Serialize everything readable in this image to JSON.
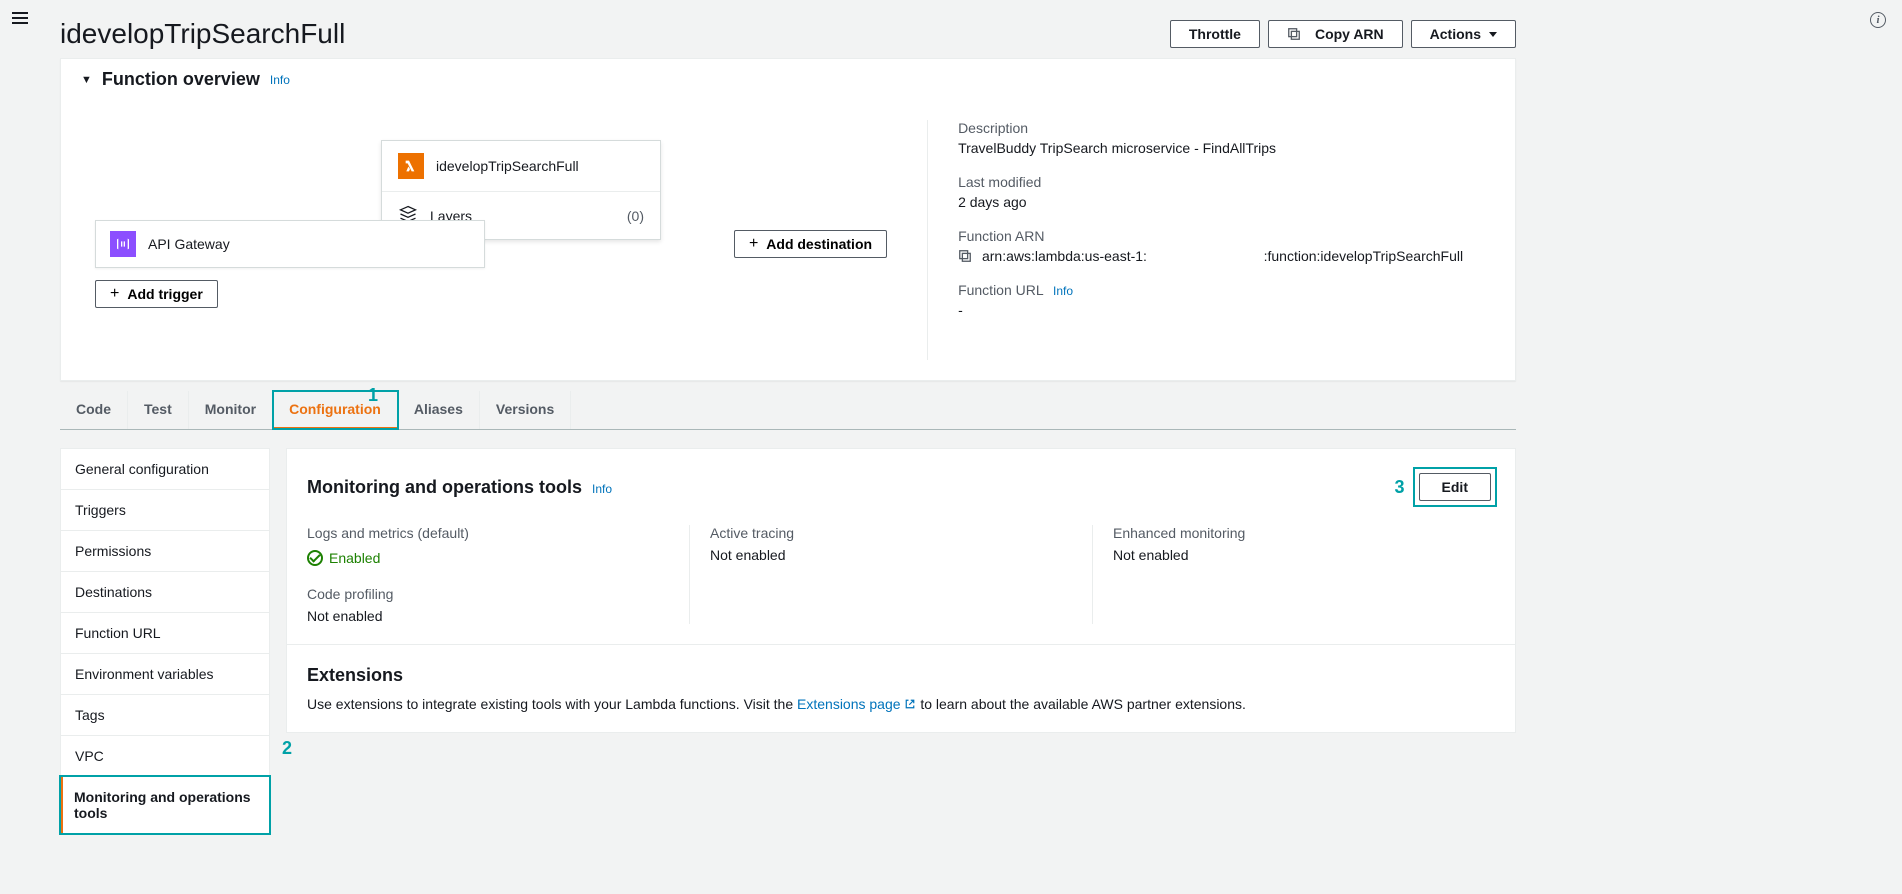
{
  "header": {
    "title": "idevelopTripSearchFull",
    "throttle": "Throttle",
    "copy_arn": "Copy ARN",
    "actions": "Actions"
  },
  "overview": {
    "section_title": "Function overview",
    "info": "Info",
    "function_name": "idevelopTripSearchFull",
    "layers_label": "Layers",
    "layers_count": "(0)",
    "trigger_name": "API Gateway",
    "add_trigger": "Add trigger",
    "add_destination": "Add destination",
    "description_label": "Description",
    "description_value": "TravelBuddy TripSearch microservice - FindAllTrips",
    "modified_label": "Last modified",
    "modified_value": "2 days ago",
    "arn_label": "Function ARN",
    "arn_value": "arn:aws:lambda:us-east-1:                              :function:idevelopTripSearchFull",
    "url_label": "Function URL",
    "url_info": "Info",
    "url_value": "-"
  },
  "tabs": {
    "code": "Code",
    "test": "Test",
    "monitor": "Monitor",
    "configuration": "Configuration",
    "aliases": "Aliases",
    "versions": "Versions"
  },
  "sidebar": {
    "items": [
      "General configuration",
      "Triggers",
      "Permissions",
      "Destinations",
      "Function URL",
      "Environment variables",
      "Tags",
      "VPC",
      "Monitoring and operations tools"
    ]
  },
  "monitoring": {
    "title": "Monitoring and operations tools",
    "info": "Info",
    "edit": "Edit",
    "logs_label": "Logs and metrics (default)",
    "logs_value": "Enabled",
    "tracing_label": "Active tracing",
    "tracing_value": "Not enabled",
    "enhanced_label": "Enhanced monitoring",
    "enhanced_value": "Not enabled",
    "profiling_label": "Code profiling",
    "profiling_value": "Not enabled",
    "extensions_title": "Extensions",
    "extensions_text_a": "Use extensions to integrate existing tools with your Lambda functions. Visit the ",
    "extensions_link": "Extensions page",
    "extensions_text_b": " to learn about the available AWS partner extensions."
  },
  "annotations": {
    "a1": "1",
    "a2": "2",
    "a3": "3"
  }
}
